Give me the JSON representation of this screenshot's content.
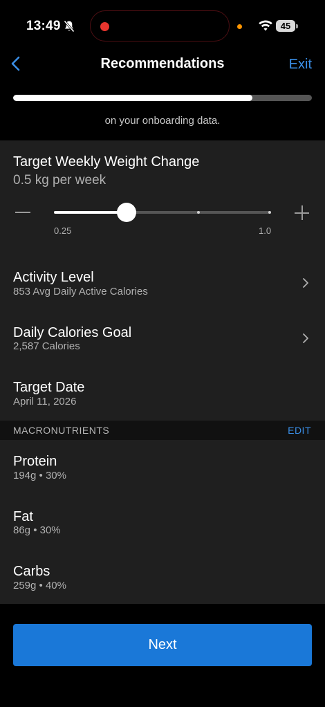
{
  "status_bar": {
    "time": "13:49",
    "battery": "45"
  },
  "header": {
    "title": "Recommendations",
    "exit_label": "Exit",
    "progress": 0.8
  },
  "subtitle": "on your onboarding data.",
  "weight_change": {
    "label": "Target Weekly Weight Change",
    "value": "0.5 kg per week",
    "slider_value": 0.335,
    "min_label": "0.25",
    "max_label": "1.0"
  },
  "activity": {
    "label": "Activity Level",
    "detail": "853 Avg Daily Active Calories"
  },
  "calories": {
    "label": "Daily Calories Goal",
    "detail": "2,587 Calories"
  },
  "target_date": {
    "label": "Target Date",
    "detail": "April 11, 2026"
  },
  "macros": {
    "section_title": "MACRONUTRIENTS",
    "edit_label": "EDIT",
    "items": [
      {
        "label": "Protein",
        "detail": "194g • 30%"
      },
      {
        "label": "Fat",
        "detail": "86g • 30%"
      },
      {
        "label": "Carbs",
        "detail": "259g • 40%"
      }
    ]
  },
  "next_label": "Next",
  "colors": {
    "accent": "#3a8ee6",
    "button": "#1a78d8",
    "recording": "#e8352e"
  },
  "icons": [
    "bell-slash-icon",
    "wifi-icon",
    "battery-icon",
    "chevron-left-icon",
    "minus-icon",
    "plus-icon",
    "chevron-right-icon"
  ]
}
